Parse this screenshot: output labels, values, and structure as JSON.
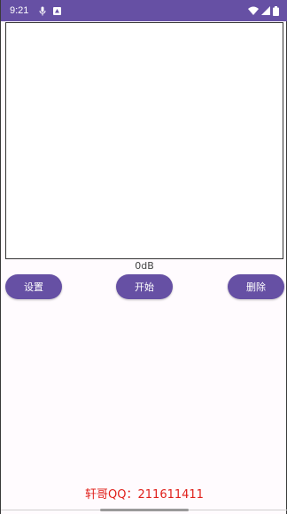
{
  "status_bar": {
    "time": "9:21",
    "left_icons": [
      "mic-icon",
      "notification-icon"
    ],
    "right_icons": [
      "wifi-icon",
      "signal-icon",
      "battery-icon"
    ],
    "background_color": "#6650a4"
  },
  "readout": {
    "db_level": "0dB"
  },
  "buttons": {
    "settings_label": "设置",
    "start_label": "开始",
    "delete_label": "删除",
    "color": "#6650a4"
  },
  "footer": {
    "contact_text": "轩哥QQ：211611411",
    "color": "#e0201b"
  }
}
